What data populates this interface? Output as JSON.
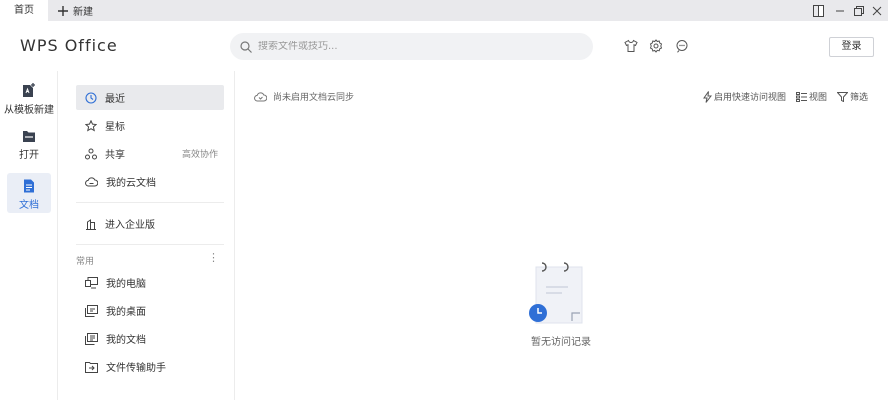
{
  "titlebar": {
    "home_tab": "首页",
    "new_tab": "新建"
  },
  "header": {
    "logo": "WPS Office",
    "search_placeholder": "搜索文件或技巧...",
    "login": "登录",
    "icons": [
      "shirt-icon",
      "gear-icon",
      "chat-icon"
    ]
  },
  "rail": {
    "items": [
      {
        "label": "从模板新建",
        "icon": "template-icon"
      },
      {
        "label": "打开",
        "icon": "folder-icon"
      },
      {
        "label": "文档",
        "icon": "document-icon",
        "active": true
      }
    ]
  },
  "nav": {
    "recent": "最近",
    "starred": "星标",
    "shared": "共享",
    "shared_extra": "高效协作",
    "cloud": "我的云文档",
    "enterprise": "进入企业版",
    "section_label": "常用",
    "computer": "我的电脑",
    "desktop": "我的桌面",
    "documents": "我的文档",
    "transfer": "文件传输助手"
  },
  "main": {
    "sync_text": "尚未启用文档云同步",
    "quick_view": "启用快速访问视图",
    "view": "视图",
    "filter": "筛选",
    "empty_text": "暂无访问记录"
  },
  "colors": {
    "accent": "#2f6fd6",
    "titlebar_bg": "#e9e9ec",
    "active_nav_bg": "#e9eaed"
  }
}
